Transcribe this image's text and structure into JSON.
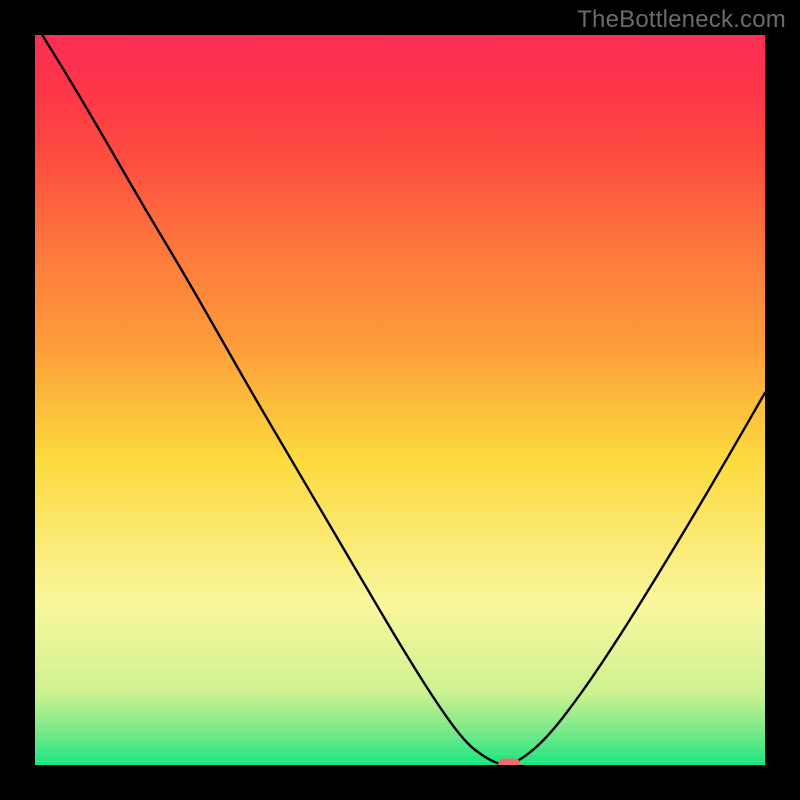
{
  "watermark": "TheBottleneck.com",
  "colors": {
    "frame": "#000000",
    "curve": "#000000",
    "marker_fill": "#ed6a6f",
    "marker_stroke": "#ed6a6f",
    "base_green": "#17e57f",
    "mid_green": "#76e888",
    "pale_green": "#cef291",
    "pale_yellow": "#faf79d",
    "yellow": "#fcd93e",
    "orange": "#fd9b3a",
    "orange2": "#fd7a3c",
    "red1": "#fd513f",
    "red2": "#fd3648",
    "red3": "#fd2e55"
  },
  "chart_data": {
    "type": "line",
    "title": "",
    "xlabel": "",
    "ylabel": "",
    "xlim": [
      0,
      100
    ],
    "ylim": [
      0,
      100
    ],
    "x": [
      1,
      5,
      10,
      15,
      20,
      25,
      30,
      35,
      40,
      45,
      50,
      55,
      59,
      62,
      64,
      66,
      70,
      75,
      80,
      85,
      90,
      95,
      100
    ],
    "y": [
      100,
      93.5,
      85,
      76.3,
      68,
      59.3,
      50.5,
      42,
      33.5,
      25,
      16.5,
      8.5,
      3,
      0.8,
      0,
      0.3,
      3.5,
      10,
      17.5,
      25.5,
      33.8,
      42.3,
      51
    ],
    "marker": {
      "x": 65,
      "y": 0
    },
    "gradient_stops": [
      {
        "offset": 0,
        "value": 100
      },
      {
        "offset": 0.2,
        "value": 80
      },
      {
        "offset": 0.45,
        "value": 55
      },
      {
        "offset": 0.7,
        "value": 30
      },
      {
        "offset": 0.88,
        "value": 12
      },
      {
        "offset": 0.93,
        "value": 7
      },
      {
        "offset": 0.965,
        "value": 3.5
      },
      {
        "offset": 1.0,
        "value": 0
      }
    ]
  }
}
